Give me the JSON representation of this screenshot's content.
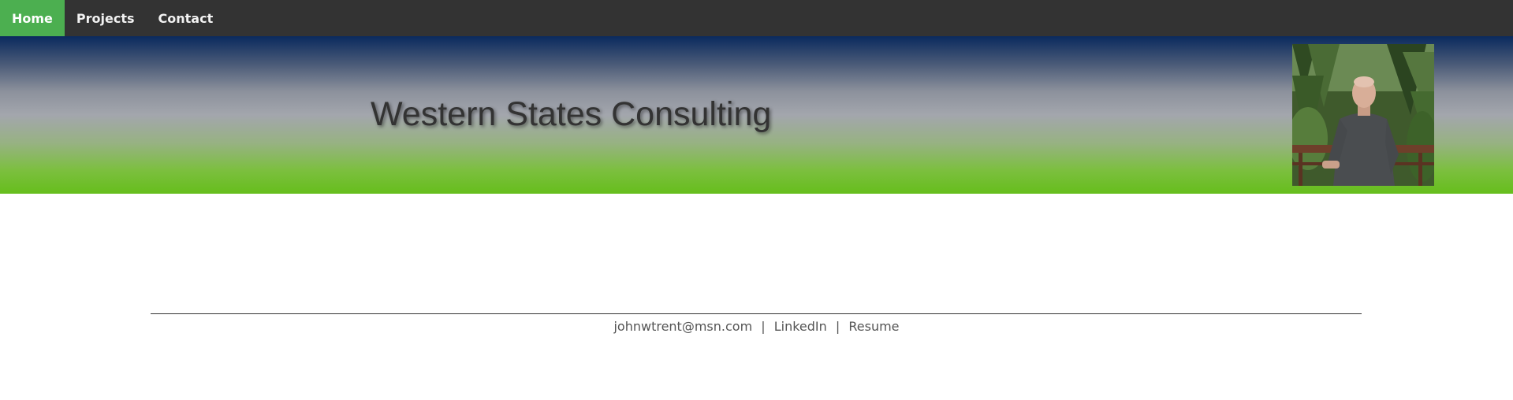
{
  "nav": {
    "items": [
      {
        "label": "Home",
        "active": true
      },
      {
        "label": "Projects",
        "active": false
      },
      {
        "label": "Contact",
        "active": false
      }
    ],
    "active_color": "#4CAF50",
    "background_color": "#333333"
  },
  "banner": {
    "title": "Western States Consulting",
    "photo_icon": "profile-photo"
  },
  "footer": {
    "email": "johnwtrent@msn.com",
    "separator": "|",
    "linkedin": "LinkedIn",
    "resume": "Resume"
  }
}
